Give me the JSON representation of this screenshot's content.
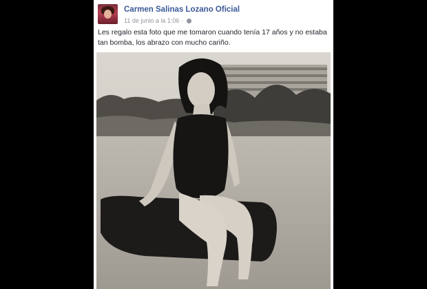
{
  "post": {
    "author": "Carmen Salinas Lozano Oficial",
    "timestamp": "11 de junio a la 1:06",
    "privacy_icon": "globe-icon",
    "text": "Les regalo esta foto que me tomaron cuando tenía 17 años y no estaba tan bomba, los abrazo con mucho cariño."
  },
  "colors": {
    "author_link": "#3b5998",
    "meta_gray": "#90949c",
    "background": "#000000",
    "card": "#ffffff"
  }
}
